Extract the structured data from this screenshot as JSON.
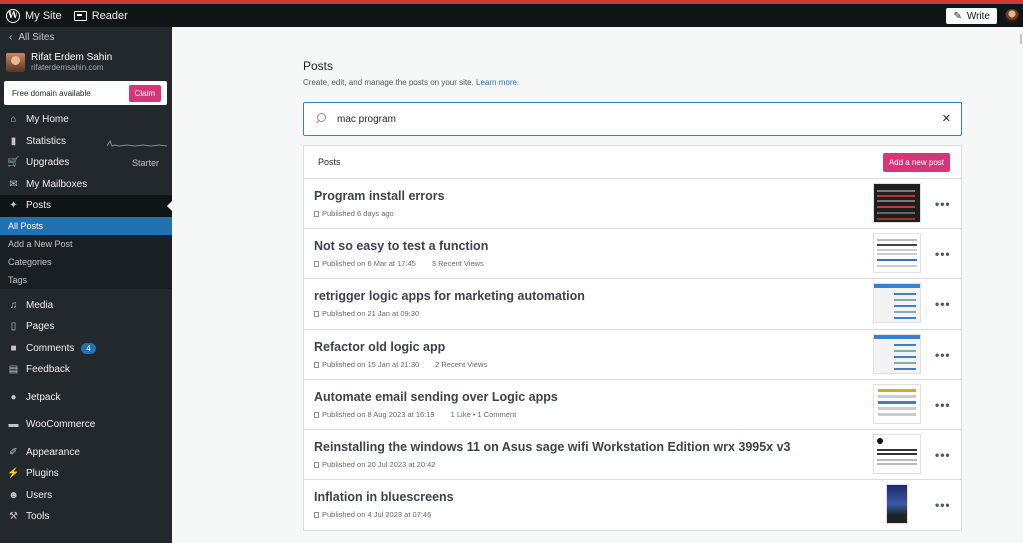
{
  "adminbar": {
    "my_site": "My Site",
    "reader": "Reader",
    "write": "Write"
  },
  "sidebar": {
    "all_sites": "All Sites",
    "site_name": "Rifat Erdem Sahin",
    "site_url": "rifaterdemsahin.com",
    "domain_text": "Free domain available",
    "claim": "Claim",
    "items": [
      {
        "label": "My Home",
        "icon": "home-icon"
      },
      {
        "label": "Statistics",
        "icon": "stats-icon"
      },
      {
        "label": "Upgrades",
        "icon": "cart-icon",
        "right": "Starter"
      },
      {
        "label": "My Mailboxes",
        "icon": "mail-icon"
      },
      {
        "label": "Posts",
        "icon": "pin-icon"
      }
    ],
    "submenu": [
      "All Posts",
      "Add a New Post",
      "Categories",
      "Tags"
    ],
    "items2": [
      {
        "label": "Media",
        "icon": "media-icon"
      },
      {
        "label": "Pages",
        "icon": "pages-icon"
      },
      {
        "label": "Comments",
        "icon": "comment-icon",
        "badge": "4"
      },
      {
        "label": "Feedback",
        "icon": "feedback-icon"
      },
      {
        "label": "Jetpack",
        "icon": "jetpack-icon"
      },
      {
        "label": "WooCommerce",
        "icon": "woo-icon"
      },
      {
        "label": "Appearance",
        "icon": "brush-icon"
      },
      {
        "label": "Plugins",
        "icon": "plugin-icon"
      },
      {
        "label": "Users",
        "icon": "users-icon"
      },
      {
        "label": "Tools",
        "icon": "tools-icon"
      }
    ]
  },
  "main": {
    "title": "Posts",
    "subtitle": "Create, edit, and manage the posts on your site.",
    "learn_more": "Learn more.",
    "search_value": "mac program",
    "list_header": "Posts",
    "add_new": "Add a new post",
    "posts": [
      {
        "title": "Program install errors",
        "meta": "Published 6 days ago",
        "extra": "",
        "thumb": "dark"
      },
      {
        "title": "Not so easy to test a function",
        "meta": "Published on 6 Mar at 17:45",
        "extra": "3 Recent Views",
        "thumb": "doc"
      },
      {
        "title": "retrigger logic apps for marketing automation",
        "meta": "Published on 21 Jan at 09:30",
        "extra": "",
        "thumb": "portal"
      },
      {
        "title": "Refactor old logic app",
        "meta": "Published on 15 Jan at 21:30",
        "extra": "2 Recent Views",
        "thumb": "portal"
      },
      {
        "title": "Automate email sending over Logic apps",
        "meta": "Published on 8 Aug 2023 at 16:19",
        "extra": "1 Like • 1 Comment",
        "thumb": "mail"
      },
      {
        "title": "Reinstalling the windows 11 on Asus sage wifi Workstation Edition wrx 3995x v3",
        "meta": "Published on 20 Jul 2023 at 20:42",
        "extra": "",
        "thumb": "win"
      },
      {
        "title": "Inflation in bluescreens",
        "meta": "Published on 4 Jul 2023 at 07:46",
        "extra": "",
        "thumb": "blue"
      }
    ]
  },
  "colors": {
    "accent": "#d63678",
    "link": "#2271b1",
    "sidebar_bg": "#23282d",
    "adminbar_bg": "#101517"
  }
}
